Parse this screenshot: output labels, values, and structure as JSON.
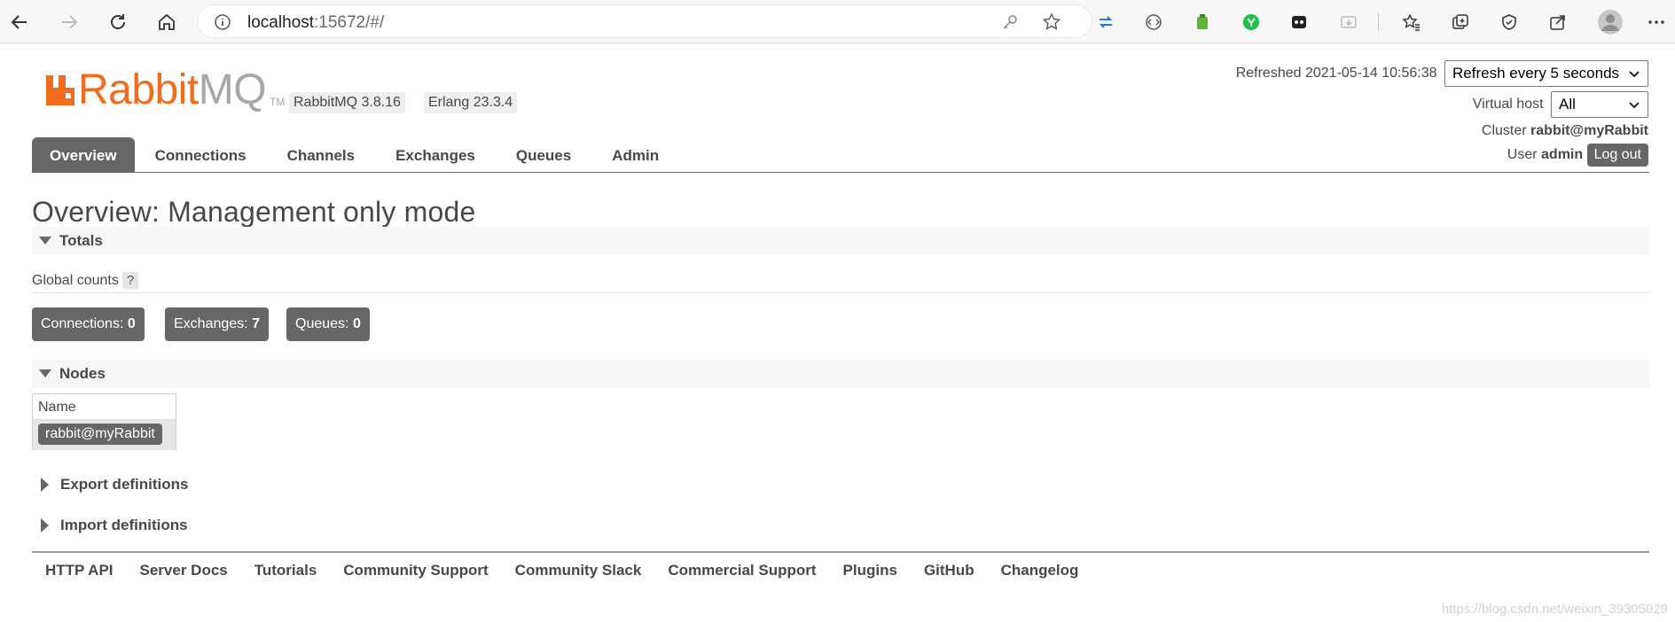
{
  "browser": {
    "url_host": "localhost",
    "url_rest": ":15672/#/"
  },
  "logo": {
    "rabbit": "Rabbit",
    "mq": "MQ",
    "tm": "TM"
  },
  "versions": {
    "rabbitmq": "RabbitMQ 3.8.16",
    "erlang": "Erlang 23.3.4"
  },
  "header": {
    "refreshed_label": "Refreshed",
    "refreshed_time": "2021-05-14 10:56:38",
    "refresh_select": "Refresh every 5 seconds",
    "vhost_label": "Virtual host",
    "vhost_select": "All",
    "cluster_label": "Cluster",
    "cluster_name": "rabbit@myRabbit",
    "user_label": "User",
    "user_name": "admin",
    "logout": "Log out"
  },
  "tabs": [
    {
      "label": "Overview",
      "active": true
    },
    {
      "label": "Connections"
    },
    {
      "label": "Channels"
    },
    {
      "label": "Exchanges"
    },
    {
      "label": "Queues"
    },
    {
      "label": "Admin"
    }
  ],
  "page_title": "Overview: Management only mode",
  "totals": {
    "heading": "Totals",
    "global_counts": "Global counts",
    "help": "?",
    "connections_label": "Connections:",
    "connections": "0",
    "exchanges_label": "Exchanges:",
    "exchanges": "7",
    "queues_label": "Queues:",
    "queues": "0"
  },
  "nodes": {
    "heading": "Nodes",
    "column_name": "Name",
    "rows": [
      "rabbit@myRabbit"
    ]
  },
  "export_definitions": "Export definitions",
  "import_definitions": "Import definitions",
  "footer": [
    "HTTP API",
    "Server Docs",
    "Tutorials",
    "Community Support",
    "Community Slack",
    "Commercial Support",
    "Plugins",
    "GitHub",
    "Changelog"
  ],
  "watermark": "https://blog.csdn.net/weixin_39305029",
  "colors": {
    "brand_orange": "#f06d1f",
    "tab_active": "#666666",
    "pill": "#666666"
  }
}
